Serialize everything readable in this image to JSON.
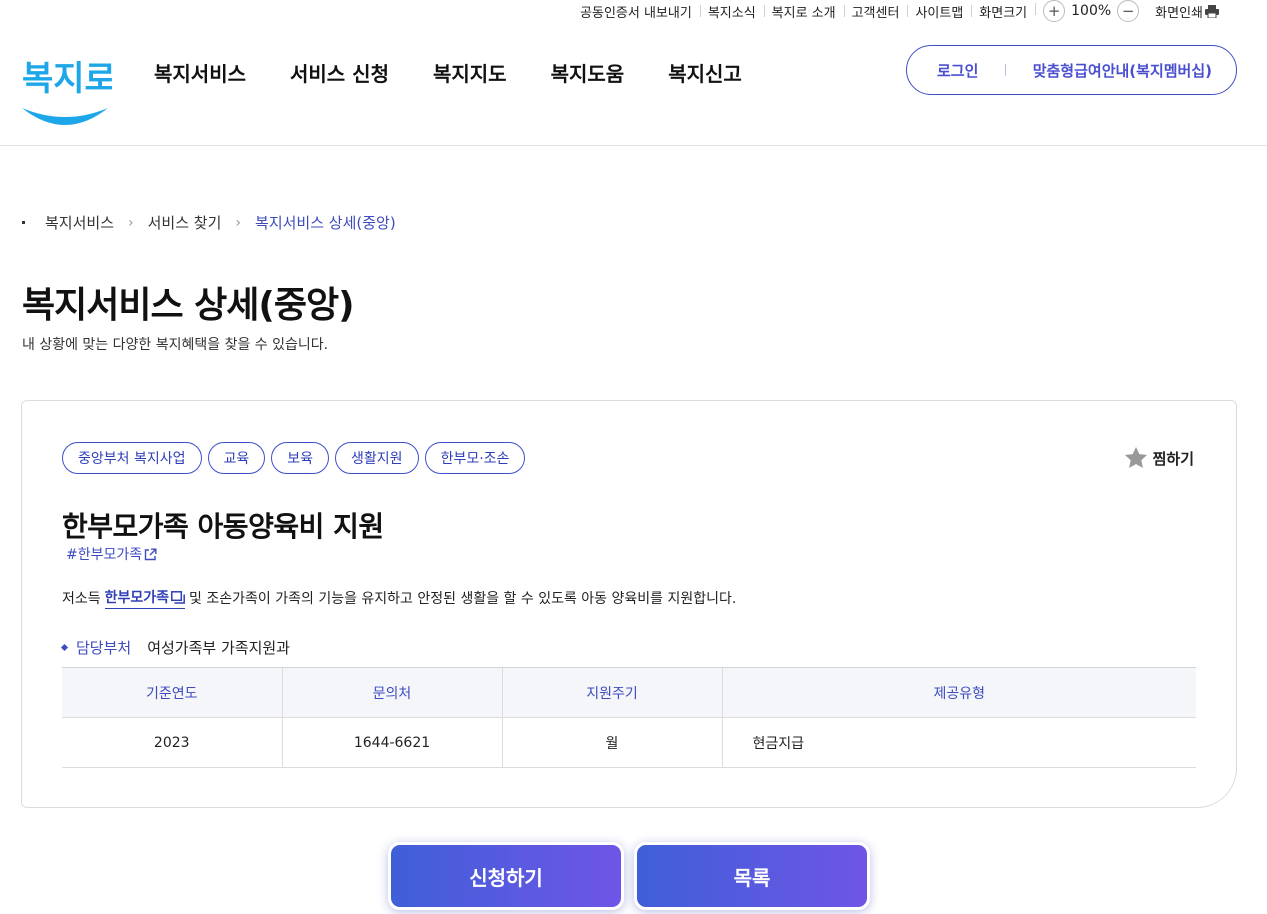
{
  "utility": {
    "cert_export": "공동인증서 내보내기",
    "news": "복지소식",
    "about": "복지로 소개",
    "support": "고객센터",
    "sitemap": "사이트맵",
    "screen_size": "화면크기",
    "zoom_in": "+",
    "zoom_value": "100%",
    "zoom_out": "−",
    "print": "화면인쇄"
  },
  "header": {
    "logo_text": "복지로",
    "nav": [
      "복지서비스",
      "서비스 신청",
      "복지지도",
      "복지도움",
      "복지신고"
    ],
    "login": "로그인",
    "membership": "맞춤형급여안내(복지멤버십)"
  },
  "breadcrumb": [
    "복지서비스",
    "서비스 찾기",
    "복지서비스 상세(중앙)"
  ],
  "page": {
    "title": "복지서비스 상세(중앙)",
    "description": "내 상황에 맞는 다양한 복지혜택을 찾을 수 있습니다."
  },
  "service": {
    "tags": [
      "중앙부처 복지사업",
      "교육",
      "보육",
      "생활지원",
      "한부모·조손"
    ],
    "favorite_label": "찜하기",
    "title": "한부모가족 아동양육비 지원",
    "hashtag": "#한부모가족",
    "desc_prefix": "저소득",
    "desc_keyword": "한부모가족",
    "desc_suffix": "및 조손가족이 가족의 기능을 유지하고 안정된 생활을 할 수 있도록 아동 양육비를 지원합니다.",
    "dept_label": "담당부처",
    "dept_value": "여성가족부 가족지원과",
    "table": {
      "headers": [
        "기준연도",
        "문의처",
        "지원주기",
        "제공유형"
      ],
      "row": [
        "2023",
        "1644-6621",
        "월",
        "현금지급"
      ]
    }
  },
  "actions": {
    "apply": "신청하기",
    "list": "목록"
  },
  "colors": {
    "accent": "#3e4bbf",
    "logo": "#1ea7e8",
    "button_start": "#3f5fd8",
    "button_end": "#6f55e6"
  }
}
